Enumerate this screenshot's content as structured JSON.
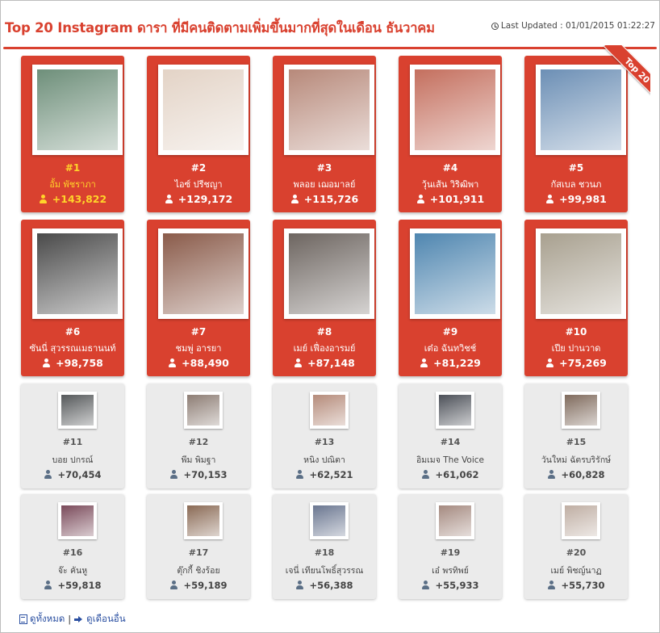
{
  "header": {
    "title": "Top 20 Instagram ดารา ที่มีคนติดตามเพิ่มขึ้นมากที่สุดในเดือน ธันวาคม",
    "last_updated": "Last Updated : 01/01/2015 01:22:27"
  },
  "ribbon": "Top 20",
  "ranking": [
    {
      "rank": "#1",
      "name": "อั้ม พัชราภา",
      "count": "+143,822",
      "photo_bg": "#6e8f7a"
    },
    {
      "rank": "#2",
      "name": "ไอซ์ ปรีชญา",
      "count": "+129,172",
      "photo_bg": "#e3d3c6"
    },
    {
      "rank": "#3",
      "name": "พลอย เฌอมาลย์",
      "count": "+115,726",
      "photo_bg": "#b7897a"
    },
    {
      "rank": "#4",
      "name": "วุ้นเส้น วิริฒิพา",
      "count": "+101,911",
      "photo_bg": "#c46f5e"
    },
    {
      "rank": "#5",
      "name": "กัสเบล ชวนภ",
      "count": "+99,981",
      "photo_bg": "#6c8fb5"
    },
    {
      "rank": "#6",
      "name": "ซันนี่ สุวรรณเมธานนท์",
      "count": "+98,758",
      "photo_bg": "#4a4a4a"
    },
    {
      "rank": "#7",
      "name": "ชมพู่ อารยา",
      "count": "+88,490",
      "photo_bg": "#8a5b4a"
    },
    {
      "rank": "#8",
      "name": "เมย์ เฟื่องอารมย์",
      "count": "+87,148",
      "photo_bg": "#6d6560"
    },
    {
      "rank": "#9",
      "name": "เต๋อ ฉันทวิชช์",
      "count": "+81,229",
      "photo_bg": "#4f86b0"
    },
    {
      "rank": "#10",
      "name": "เปีย ปานวาด",
      "count": "+75,269",
      "photo_bg": "#a8a08f"
    },
    {
      "rank": "#11",
      "name": "บอย ปกรณ์",
      "count": "+70,454",
      "photo_bg": "#55585a"
    },
    {
      "rank": "#12",
      "name": "พีม พิมฐา",
      "count": "+70,153",
      "photo_bg": "#8d7d74"
    },
    {
      "rank": "#13",
      "name": "หนิง ปณิตา",
      "count": "+62,521",
      "photo_bg": "#b58b7a"
    },
    {
      "rank": "#14",
      "name": "อิมเมจ The Voice",
      "count": "+61,062",
      "photo_bg": "#4c5058"
    },
    {
      "rank": "#15",
      "name": "วันใหม่ ฉัตรบริรักษ์",
      "count": "+60,828",
      "photo_bg": "#7f6a5c"
    },
    {
      "rank": "#16",
      "name": "จ๊ะ คันหู",
      "count": "+59,818",
      "photo_bg": "#7a4a5a"
    },
    {
      "rank": "#17",
      "name": "ตุ๊กกี้ ชิงร้อย",
      "count": "+59,189",
      "photo_bg": "#8a6a55"
    },
    {
      "rank": "#18",
      "name": "เจนี่ เทียนโพธิ์สุวรรณ",
      "count": "+56,388",
      "photo_bg": "#6a7690"
    },
    {
      "rank": "#19",
      "name": "เอ๋ พรทิพย์",
      "count": "+55,933",
      "photo_bg": "#a58a80"
    },
    {
      "rank": "#20",
      "name": "เมย์ พิชญ์นาฏ",
      "count": "+55,730",
      "photo_bg": "#bfaea3"
    }
  ],
  "footer": {
    "view_all": "ดูทั้งหมด",
    "separator": "|",
    "other_months": "ดูเดือนอื่น"
  },
  "colors": {
    "accent": "#d9412f",
    "first_place": "#ffd42a",
    "grey_card": "#ebebeb",
    "link": "#2a4fa1"
  }
}
